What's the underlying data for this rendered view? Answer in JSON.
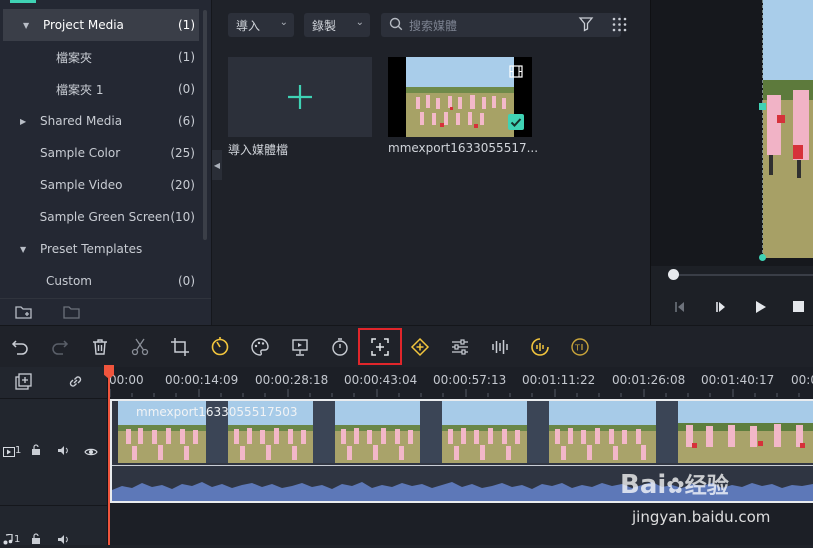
{
  "library": {
    "tree": [
      {
        "label": "Project Media",
        "count": "(1)",
        "arrow": "down",
        "selected": true
      },
      {
        "label": "檔案夾",
        "count": "(1)",
        "indent": true
      },
      {
        "label": "檔案夾 1",
        "count": "(0)",
        "indent": true
      },
      {
        "label": "Shared Media",
        "count": "(6)",
        "arrow": "right"
      },
      {
        "label": "Sample Color",
        "count": "(25)"
      },
      {
        "label": "Sample Video",
        "count": "(20)"
      },
      {
        "label": "Sample Green Screen",
        "count": "(10)"
      },
      {
        "label": "Preset Templates",
        "count": "",
        "arrow": "down"
      },
      {
        "label": "Custom",
        "count": "(0)",
        "indent": true
      }
    ]
  },
  "media": {
    "import_label": "導入",
    "record_label": "錄製",
    "search_placeholder": "搜索媒體",
    "import_tile_label": "導入媒體檔",
    "clip_tile_label": "mmexport1633055517..."
  },
  "toolbar": {
    "icons": [
      "undo-icon",
      "redo-icon",
      "delete-icon",
      "cut-icon",
      "crop-icon",
      "speed-icon",
      "color-icon",
      "stabilize-icon",
      "duration-icon",
      "crop-zoom-icon",
      "keyframe-icon",
      "adjust-icon",
      "audio-mix-icon",
      "silence-detect-icon",
      "speech-to-text-icon"
    ]
  },
  "timeline": {
    "ruler": [
      "00:00",
      "00:00:14:09",
      "00:00:28:18",
      "00:00:43:04",
      "00:00:57:13",
      "00:01:11:22",
      "00:01:26:08",
      "00:01:40:17",
      "00:0"
    ],
    "clip_name": "mmexport1633055517503",
    "video_track_num": "1",
    "audio_track_num": "1"
  },
  "watermark": {
    "brand": "Bai",
    "brand2": "经验",
    "url": "jingyan.baidu.com"
  },
  "colors": {
    "accent": "#3fd2b4",
    "highlight": "#e0262b",
    "playhead": "#f0553d"
  }
}
